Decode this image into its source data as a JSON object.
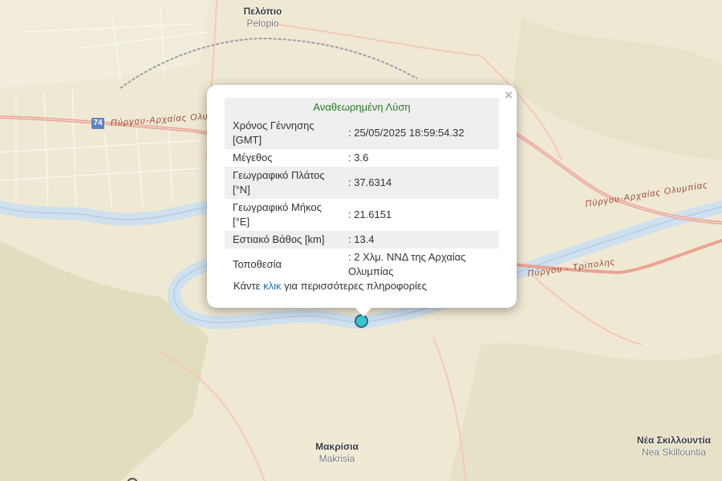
{
  "map": {
    "places": [
      {
        "id": "pelopio",
        "name_gr": "Πελόπιο",
        "name_lat": "Pelopio"
      },
      {
        "id": "makrisia",
        "name_gr": "Μακρίσια",
        "name_lat": "Makrisia"
      },
      {
        "id": "nea-skillountia",
        "name_gr": "Νέα Σκιλλουντία",
        "name_lat": "Nea Skillountia"
      }
    ],
    "roads": {
      "west_label": "Πύργου-Αρχαίας Ολυ",
      "east_label": "Πύργου-Αρχαίας Ολυμπίας",
      "tripoli_label": "Πύργου - Τρίπολης"
    },
    "route_shield": "74",
    "colors": {
      "land": "#efe9d4",
      "river": "#cfe0ef",
      "main_road": "#e8a493",
      "popup_title": "#2a7a2a",
      "link": "#1f6fb8",
      "marker": "#39c3d3"
    }
  },
  "popup": {
    "title": "Αναθεωρημένη Λύση",
    "rows": [
      {
        "label": "Χρόνος Γέννησης [GMT]",
        "value": ": 25/05/2025 18:59:54.32"
      },
      {
        "label": "Μέγεθος",
        "value": ": 3.6"
      },
      {
        "label": "Γεωγραφικό Πλάτος [°N]",
        "value": ": 37.6314"
      },
      {
        "label": "Γεωγραφικό Μήκος [°E]",
        "value": ": 21.6151"
      },
      {
        "label": "Εστιακό Βάθος [km]",
        "value": ": 13.4"
      },
      {
        "label": "Τοποθεσία",
        "value": ": 2 Χλμ. ΝΝΔ της Αρχαίας Ολυμπίας"
      }
    ],
    "more_prefix": "Κάντε ",
    "more_link": "κλικ",
    "more_suffix": " για περισσότερες πληροφορίες",
    "close_symbol": "×",
    "close_icon": "close-icon"
  }
}
